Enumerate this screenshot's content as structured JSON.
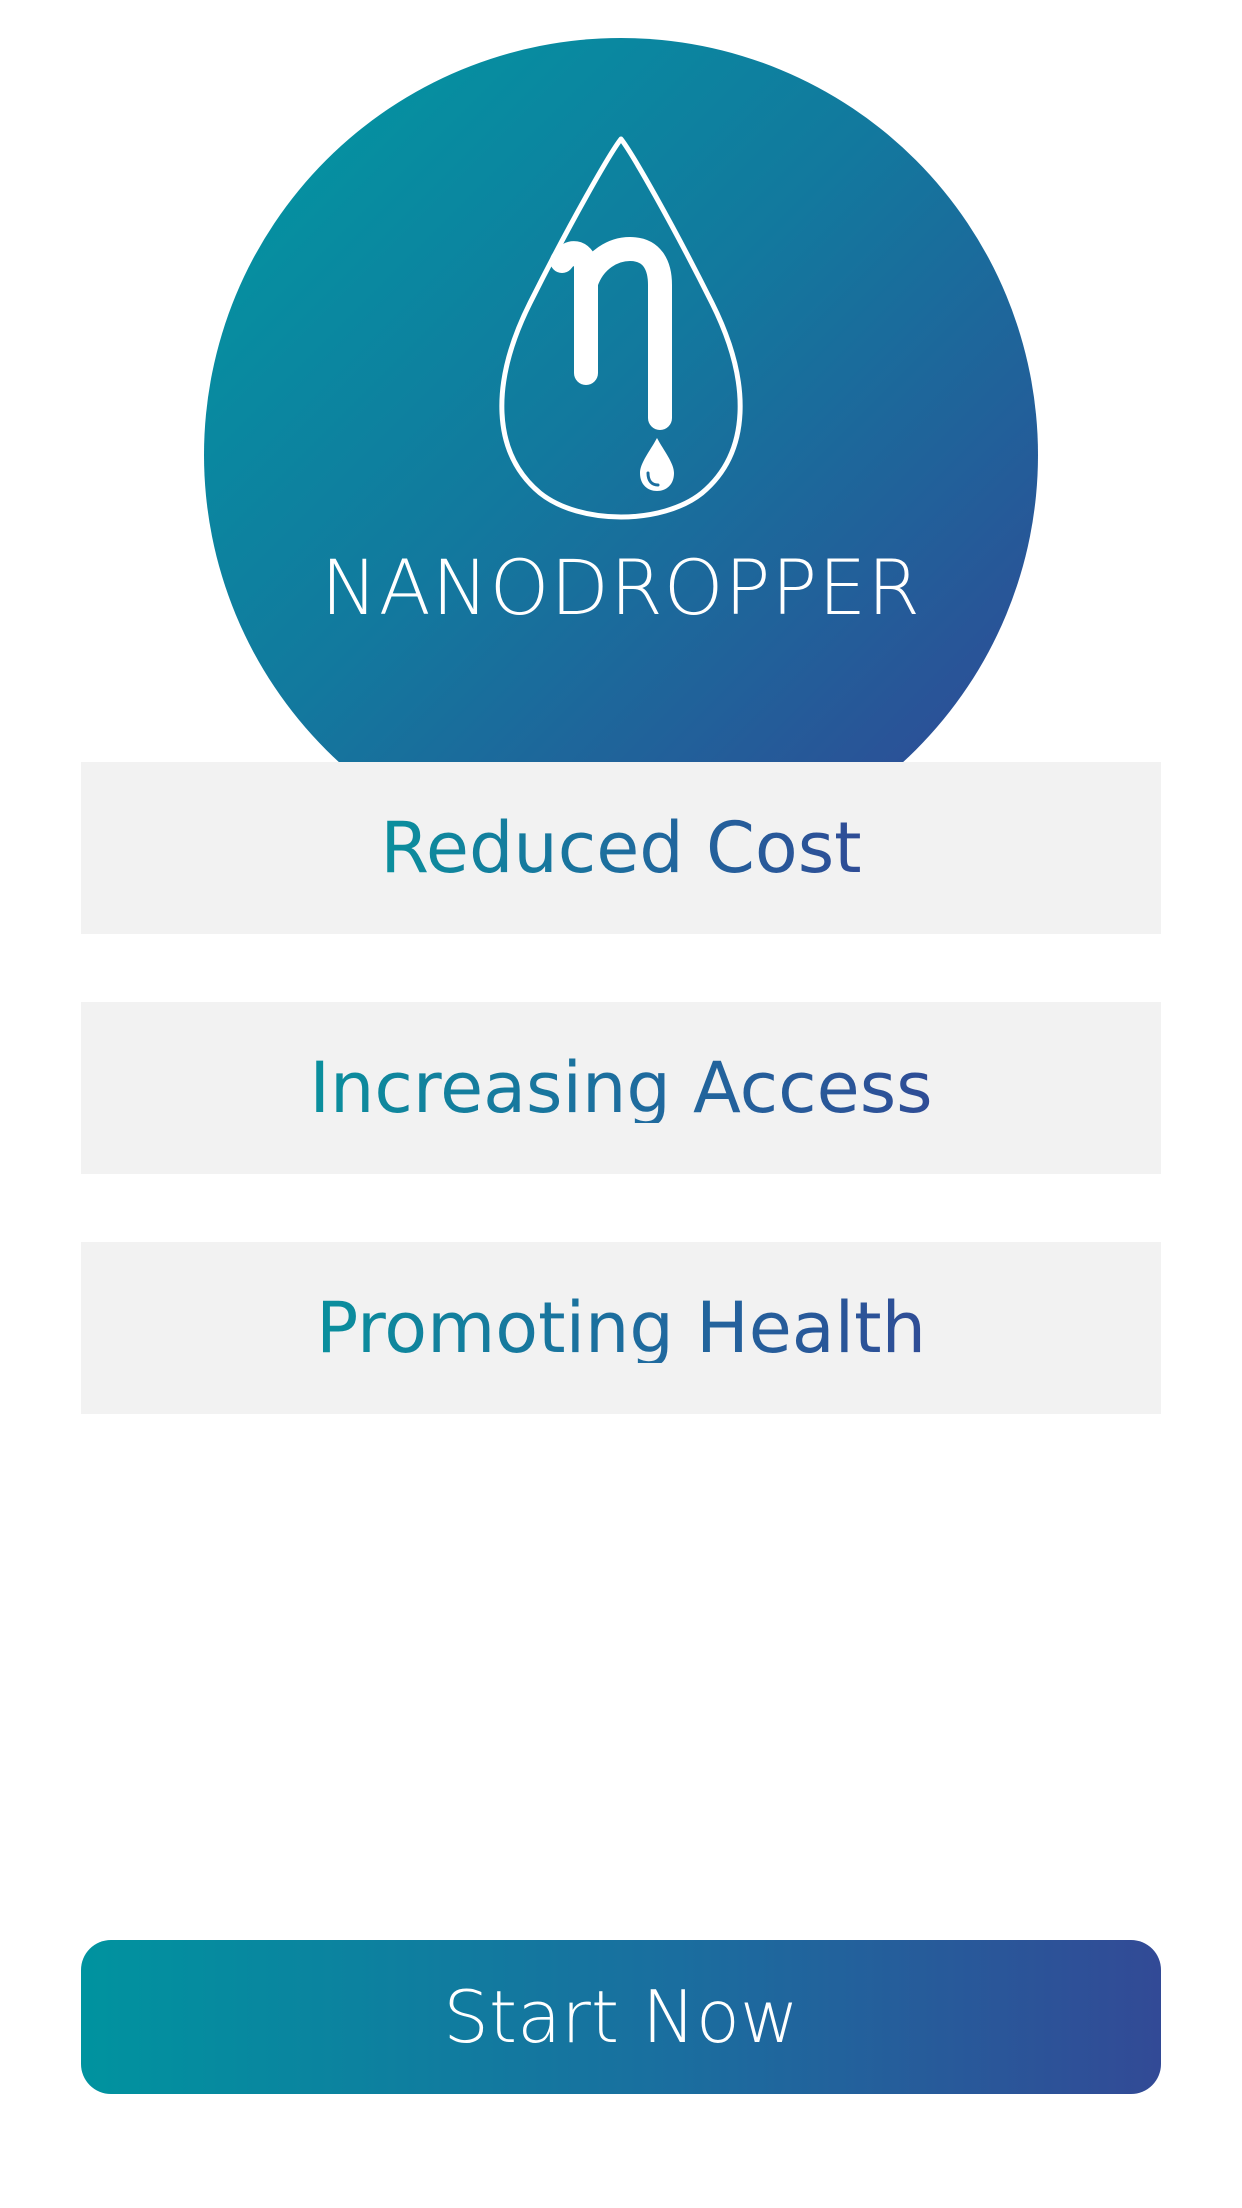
{
  "brand": {
    "name": "NANODROPPER",
    "logo_icon": "water-drop-eta-icon",
    "colors": {
      "gradient_start": "#009aa2",
      "gradient_end": "#334495"
    }
  },
  "features": [
    {
      "label": "Reduced Cost"
    },
    {
      "label": "Increasing Access"
    },
    {
      "label": "Promoting Health"
    }
  ],
  "cta": {
    "label": "Start Now"
  }
}
